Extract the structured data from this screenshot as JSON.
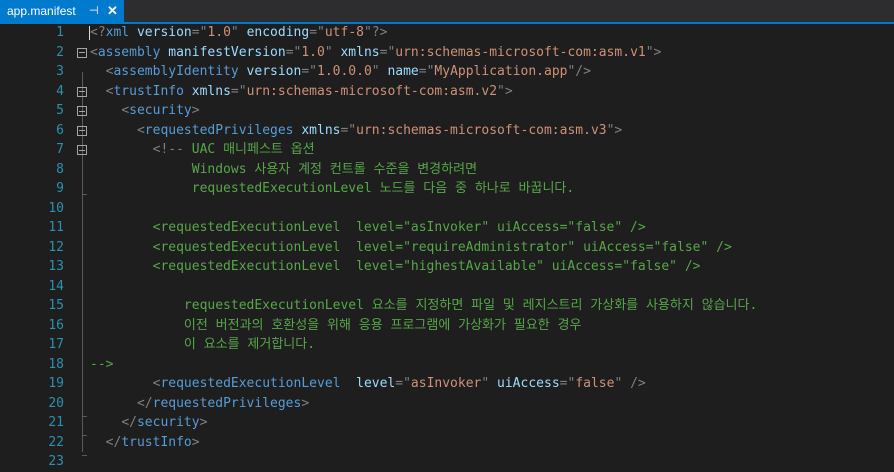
{
  "tab": {
    "title": "app.manifest",
    "pin_glyph": "⊣",
    "close_glyph": "✕"
  },
  "editor": {
    "lines": [
      {
        "n": "1",
        "segs": [
          [
            "d",
            "<?"
          ],
          [
            "e",
            "xml"
          ],
          [
            "t",
            " "
          ],
          [
            "a",
            "version"
          ],
          [
            "d",
            "=\""
          ],
          [
            "v",
            "1.0"
          ],
          [
            "d",
            "\""
          ],
          [
            "t",
            " "
          ],
          [
            "a",
            "encoding"
          ],
          [
            "d",
            "=\""
          ],
          [
            "v",
            "utf-8"
          ],
          [
            "d",
            "\"?>"
          ]
        ]
      },
      {
        "n": "2",
        "fold": true,
        "segs": [
          [
            "d",
            "<"
          ],
          [
            "e",
            "assembly"
          ],
          [
            "t",
            " "
          ],
          [
            "a",
            "manifestVersion"
          ],
          [
            "d",
            "=\""
          ],
          [
            "v",
            "1.0"
          ],
          [
            "d",
            "\""
          ],
          [
            "t",
            " "
          ],
          [
            "a",
            "xmlns"
          ],
          [
            "d",
            "=\""
          ],
          [
            "v",
            "urn:schemas-microsoft-com:asm.v1"
          ],
          [
            "d",
            "\">"
          ]
        ]
      },
      {
        "n": "3",
        "segs": [
          [
            "t",
            "  "
          ],
          [
            "d",
            "<"
          ],
          [
            "e",
            "assemblyIdentity"
          ],
          [
            "t",
            " "
          ],
          [
            "a",
            "version"
          ],
          [
            "d",
            "=\""
          ],
          [
            "v",
            "1.0.0.0"
          ],
          [
            "d",
            "\""
          ],
          [
            "t",
            " "
          ],
          [
            "a",
            "name"
          ],
          [
            "d",
            "=\""
          ],
          [
            "v",
            "MyApplication.app"
          ],
          [
            "d",
            "\"/>"
          ]
        ]
      },
      {
        "n": "4",
        "fold": true,
        "segs": [
          [
            "t",
            "  "
          ],
          [
            "d",
            "<"
          ],
          [
            "e",
            "trustInfo"
          ],
          [
            "t",
            " "
          ],
          [
            "a",
            "xmlns"
          ],
          [
            "d",
            "=\""
          ],
          [
            "v",
            "urn:schemas-microsoft-com:asm.v2"
          ],
          [
            "d",
            "\">"
          ]
        ]
      },
      {
        "n": "5",
        "fold": true,
        "segs": [
          [
            "t",
            "    "
          ],
          [
            "d",
            "<"
          ],
          [
            "e",
            "security"
          ],
          [
            "d",
            ">"
          ]
        ]
      },
      {
        "n": "6",
        "fold": true,
        "segs": [
          [
            "t",
            "      "
          ],
          [
            "d",
            "<"
          ],
          [
            "e",
            "requestedPrivileges"
          ],
          [
            "t",
            " "
          ],
          [
            "a",
            "xmlns"
          ],
          [
            "d",
            "=\""
          ],
          [
            "v",
            "urn:schemas-microsoft-com:asm.v3"
          ],
          [
            "d",
            "\">"
          ]
        ]
      },
      {
        "n": "7",
        "fold": true,
        "segs": [
          [
            "t",
            "        "
          ],
          [
            "d",
            "<!--"
          ],
          [
            "c",
            " UAC 매니페스트 옵션"
          ]
        ]
      },
      {
        "n": "8",
        "segs": [
          [
            "c",
            "             Windows 사용자 계정 컨트롤 수준을 변경하려면"
          ]
        ]
      },
      {
        "n": "9",
        "segs": [
          [
            "c",
            "             requestedExecutionLevel 노드를 다음 중 하나로 바꿉니다."
          ]
        ]
      },
      {
        "n": "10",
        "segs": []
      },
      {
        "n": "11",
        "segs": [
          [
            "c",
            "        <requestedExecutionLevel  level=\"asInvoker\" uiAccess=\"false\" />"
          ]
        ]
      },
      {
        "n": "12",
        "segs": [
          [
            "c",
            "        <requestedExecutionLevel  level=\"requireAdministrator\" uiAccess=\"false\" />"
          ]
        ]
      },
      {
        "n": "13",
        "segs": [
          [
            "c",
            "        <requestedExecutionLevel  level=\"highestAvailable\" uiAccess=\"false\" />"
          ]
        ]
      },
      {
        "n": "14",
        "segs": []
      },
      {
        "n": "15",
        "segs": [
          [
            "c",
            "            requestedExecutionLevel 요소를 지정하면 파일 및 레지스트리 가상화를 사용하지 않습니다."
          ]
        ]
      },
      {
        "n": "16",
        "segs": [
          [
            "c",
            "            이전 버전과의 호환성을 위해 응용 프로그램에 가상화가 필요한 경우"
          ]
        ]
      },
      {
        "n": "17",
        "segs": [
          [
            "c",
            "            이 요소를 제거합니다."
          ]
        ]
      },
      {
        "n": "18",
        "segs": [
          [
            "c",
            "-->"
          ]
        ]
      },
      {
        "n": "19",
        "segs": [
          [
            "t",
            "        "
          ],
          [
            "d",
            "<"
          ],
          [
            "e",
            "requestedExecutionLevel"
          ],
          [
            "t",
            "  "
          ],
          [
            "a",
            "level"
          ],
          [
            "d",
            "=\""
          ],
          [
            "v",
            "asInvoker"
          ],
          [
            "d",
            "\""
          ],
          [
            "t",
            " "
          ],
          [
            "a",
            "uiAccess"
          ],
          [
            "d",
            "=\""
          ],
          [
            "v",
            "false"
          ],
          [
            "d",
            "\""
          ],
          [
            "t",
            " "
          ],
          [
            "d",
            "/>"
          ]
        ]
      },
      {
        "n": "20",
        "segs": [
          [
            "t",
            "      "
          ],
          [
            "d",
            "</"
          ],
          [
            "e",
            "requestedPrivileges"
          ],
          [
            "d",
            ">"
          ]
        ]
      },
      {
        "n": "21",
        "segs": [
          [
            "t",
            "    "
          ],
          [
            "d",
            "</"
          ],
          [
            "e",
            "security"
          ],
          [
            "d",
            ">"
          ]
        ]
      },
      {
        "n": "22",
        "segs": [
          [
            "t",
            "  "
          ],
          [
            "d",
            "</"
          ],
          [
            "e",
            "trustInfo"
          ],
          [
            "d",
            ">"
          ]
        ]
      },
      {
        "n": "23",
        "segs": []
      }
    ]
  }
}
